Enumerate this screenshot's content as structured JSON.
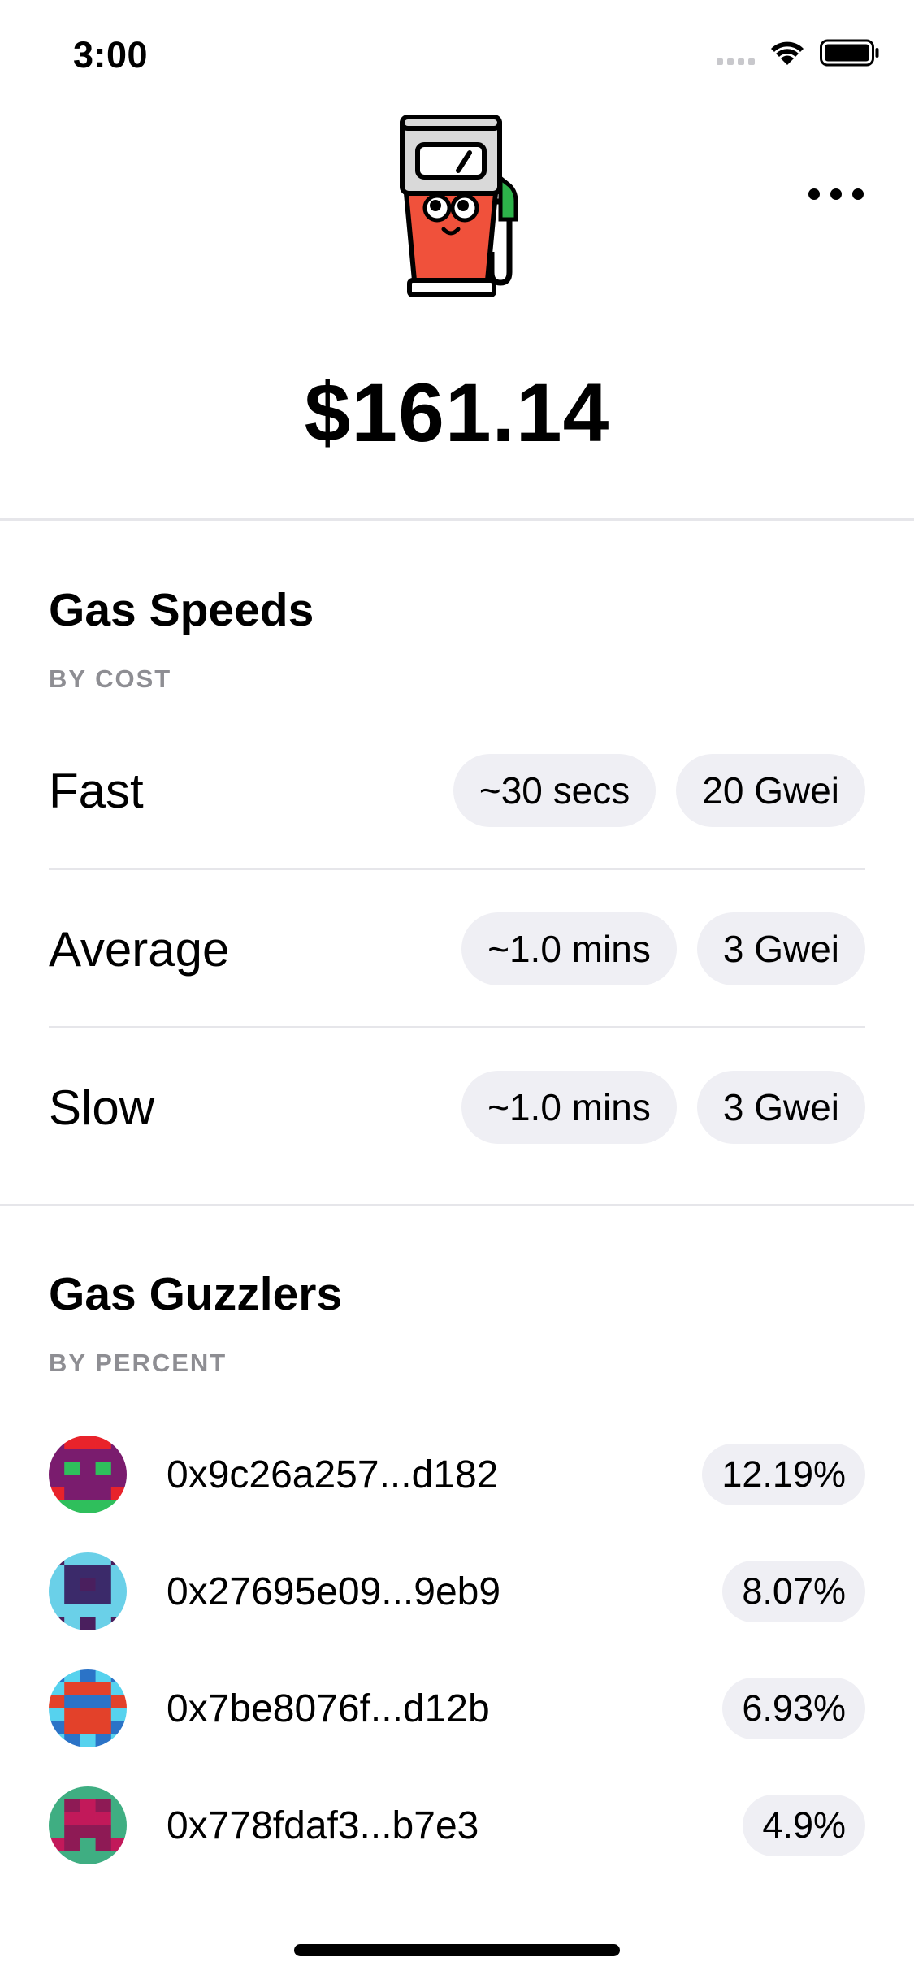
{
  "status": {
    "time": "3:00"
  },
  "header": {
    "balance": "$161.14"
  },
  "gas_speeds": {
    "title": "Gas Speeds",
    "subtitle": "BY COST",
    "rows": [
      {
        "label": "Fast",
        "time": "~30 secs",
        "price": "20 Gwei"
      },
      {
        "label": "Average",
        "time": "~1.0 mins",
        "price": "3 Gwei"
      },
      {
        "label": "Slow",
        "time": "~1.0 mins",
        "price": "3 Gwei"
      }
    ]
  },
  "gas_guzzlers": {
    "title": "Gas Guzzlers",
    "subtitle": "BY PERCENT",
    "rows": [
      {
        "address": "0x9c26a257...d182",
        "percent": "12.19%",
        "avatar_colors": [
          "#e8232b",
          "#7a1c6e",
          "#2fbf5c"
        ]
      },
      {
        "address": "0x27695e09...9eb9",
        "percent": "8.07%",
        "avatar_colors": [
          "#4a1f5e",
          "#6ad0e8",
          "#3b2a6a"
        ]
      },
      {
        "address": "0x7be8076f...d12b",
        "percent": "6.93%",
        "avatar_colors": [
          "#2b73c7",
          "#e3412a",
          "#56d2ee"
        ]
      },
      {
        "address": "0x778fdaf3...b7e3",
        "percent": "4.9%",
        "avatar_colors": [
          "#c2195a",
          "#3fae82",
          "#8e1a55"
        ]
      }
    ]
  },
  "icons": {
    "mascot": "gas-pump-mascot-icon",
    "menu": "more-dots-icon",
    "wifi": "wifi-icon",
    "battery": "battery-icon",
    "signal": "cellular-signal-icon"
  }
}
